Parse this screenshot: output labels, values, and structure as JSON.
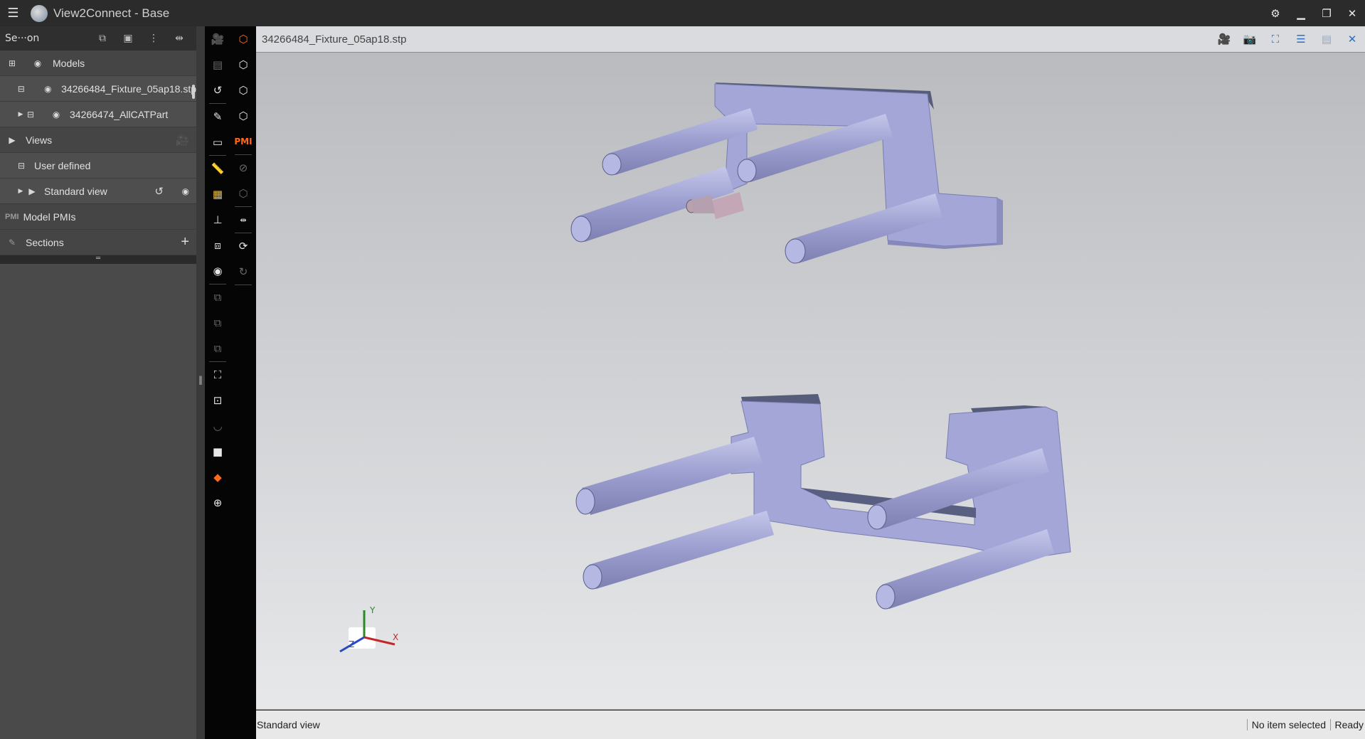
{
  "window": {
    "title": "View2Connect - Base"
  },
  "left_panel": {
    "header_label": "Se···on",
    "rows": {
      "models": "Models",
      "model1": "34266484_Fixture_05ap18.stp",
      "model2": "34266474_AllCATPart",
      "views": "Views",
      "user_defined": "User defined",
      "standard_view": "Standard view",
      "pmi_label": "PMI",
      "model_pmis": "Model PMIs",
      "sections": "Sections"
    }
  },
  "viewport": {
    "file_name": "34266484_Fixture_05ap18.stp",
    "axes": {
      "x": "X",
      "y": "Y",
      "z": "Z"
    }
  },
  "toolbar": {
    "pmi_label": "PMI"
  },
  "status": {
    "view": "Standard view",
    "selection": "No item selected",
    "state": "Ready"
  },
  "colors": {
    "accent": "#ff6a1a",
    "part": "#a3a6d6",
    "icon_blue": "#2a6fc9"
  }
}
